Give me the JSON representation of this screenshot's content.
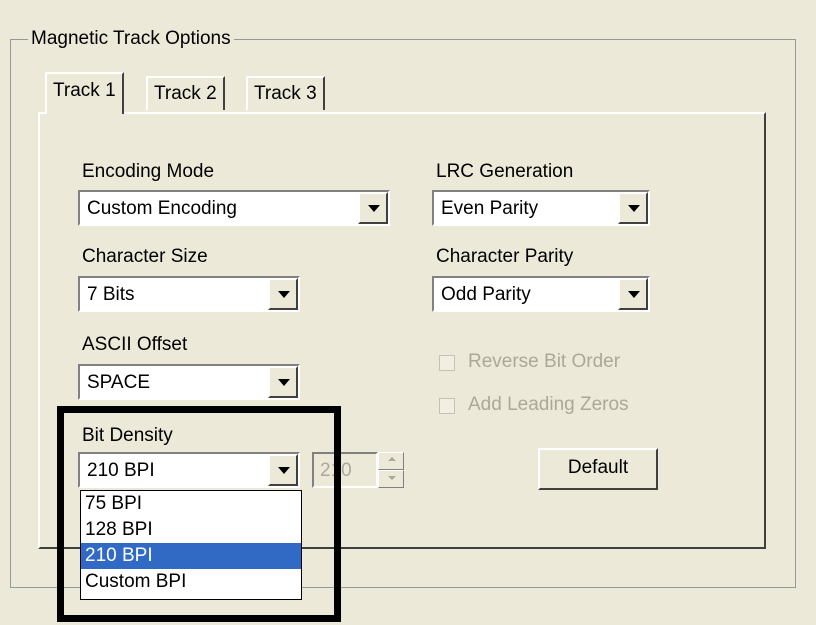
{
  "group_title": "Magnetic Track Options",
  "tabs": [
    {
      "label": "Track 1",
      "active": true
    },
    {
      "label": "Track 2",
      "active": false
    },
    {
      "label": "Track 3",
      "active": false
    }
  ],
  "encoding_mode": {
    "label": "Encoding Mode",
    "value": "Custom Encoding"
  },
  "lrc_generation": {
    "label": "LRC Generation",
    "value": "Even Parity"
  },
  "character_size": {
    "label": "Character Size",
    "value": "7 Bits"
  },
  "character_parity": {
    "label": "Character Parity",
    "value": "Odd Parity"
  },
  "ascii_offset": {
    "label": "ASCII Offset",
    "value": "SPACE"
  },
  "reverse_bit_order": {
    "label": "Reverse Bit Order",
    "checked": false,
    "enabled": false
  },
  "add_leading_zeros": {
    "label": "Add Leading Zeros",
    "checked": false,
    "enabled": false
  },
  "bit_density": {
    "label": "Bit Density",
    "value": "210 BPI",
    "spinner_value": "210",
    "options": [
      "75 BPI",
      "128 BPI",
      "210 BPI",
      "Custom BPI"
    ],
    "selected_index": 2
  },
  "default_button": "Default",
  "colors": {
    "background": "#ece9d8",
    "selection": "#316ac5",
    "disabled_text": "#aca899"
  }
}
